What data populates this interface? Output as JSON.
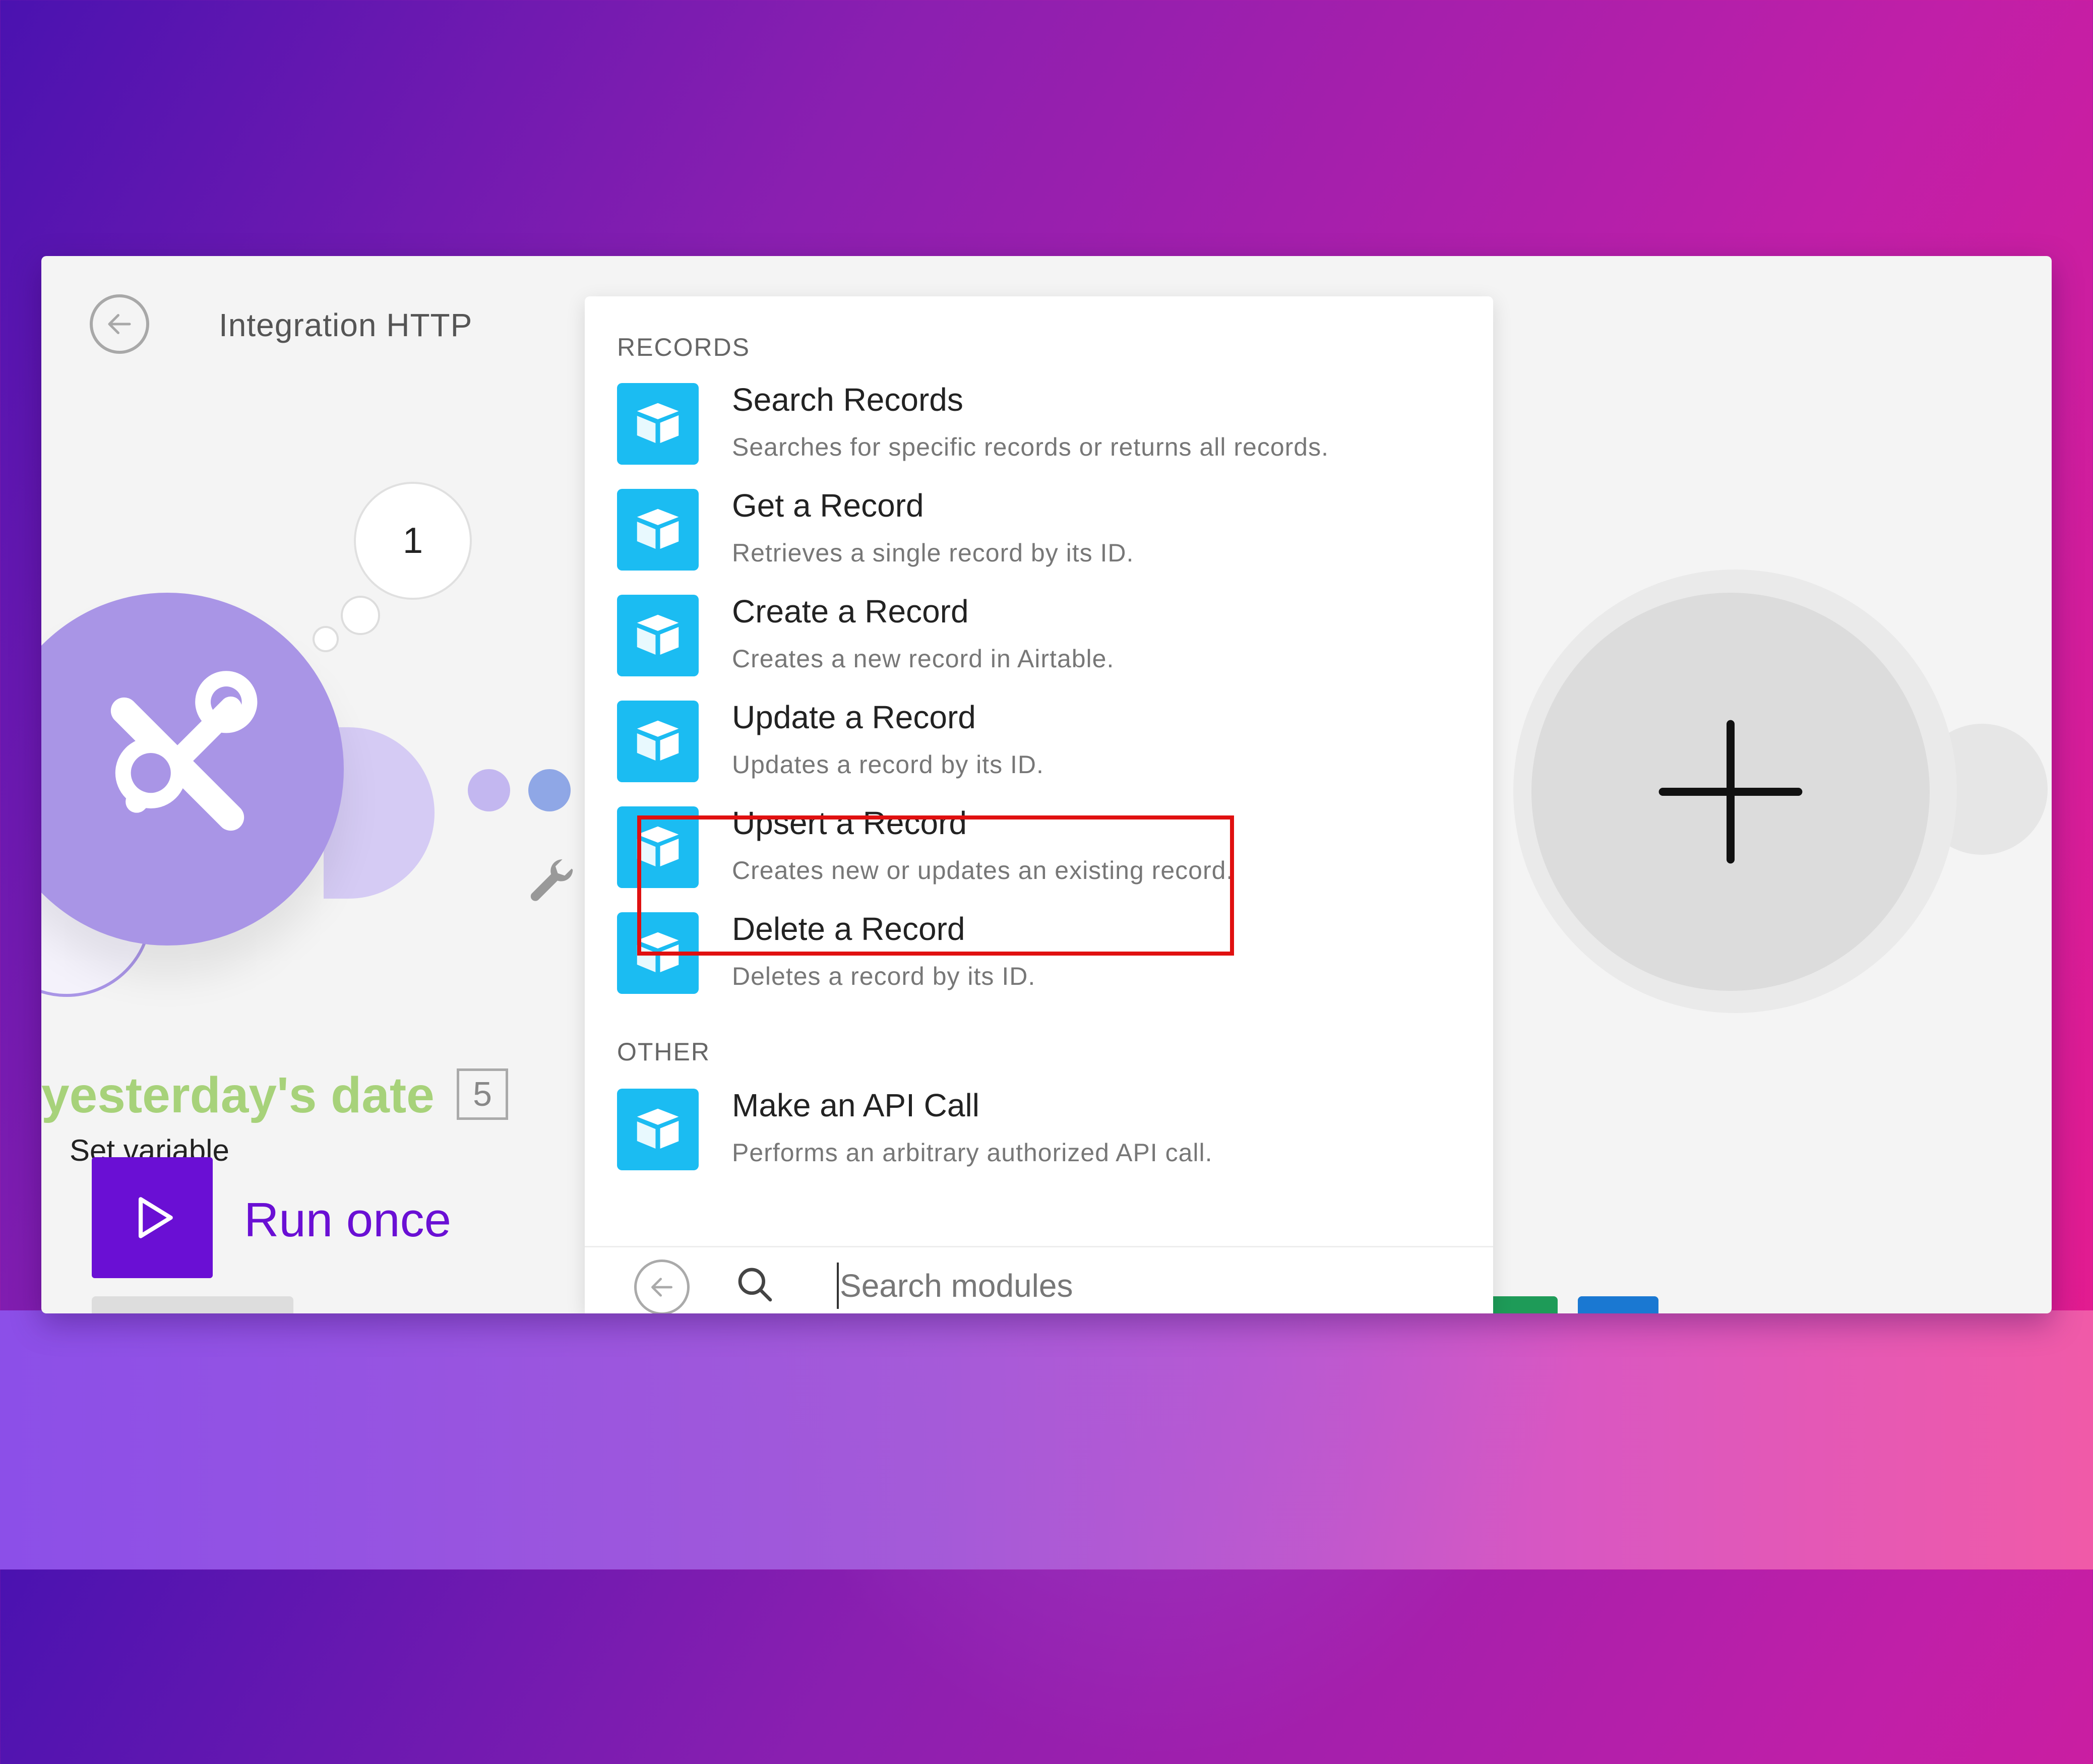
{
  "scenario": {
    "title": "Integration HTTP"
  },
  "canvas": {
    "bubble_count": "1",
    "module_name": "yesterday's date",
    "module_badge": "5",
    "module_subtitle": "Set variable"
  },
  "run": {
    "label": "Run once"
  },
  "picker": {
    "sections": [
      {
        "label": "RECORDS",
        "items": [
          {
            "title": "Search Records",
            "description": "Searches for specific records or returns all records."
          },
          {
            "title": "Get a Record",
            "description": "Retrieves a single record by its ID."
          },
          {
            "title": "Create a Record",
            "description": "Creates a new record in Airtable."
          },
          {
            "title": "Update a Record",
            "description": "Updates a record by its ID."
          },
          {
            "title": "Upsert a Record",
            "description": "Creates new or updates an existing record."
          },
          {
            "title": "Delete a Record",
            "description": "Deletes a record by its ID."
          }
        ]
      },
      {
        "label": "OTHER",
        "items": [
          {
            "title": "Make an API Call",
            "description": "Performs an arbitrary authorized API call."
          }
        ]
      }
    ],
    "highlighted_item": "Create a Record",
    "search": {
      "placeholder": "Search modules",
      "value": ""
    }
  },
  "icons": {
    "back": "arrow-left-icon",
    "tools": "tools-icon",
    "wrench": "wrench-icon",
    "play": "play-icon",
    "add": "plus-icon",
    "module": "airtable-icon",
    "search": "search-icon"
  },
  "colors": {
    "airtable_blue": "#1bbcf2",
    "run_purple": "#6a0fd4",
    "highlight_red": "#e01010",
    "module_green": "#a7d27a",
    "tools_purple": "#a995e6"
  }
}
